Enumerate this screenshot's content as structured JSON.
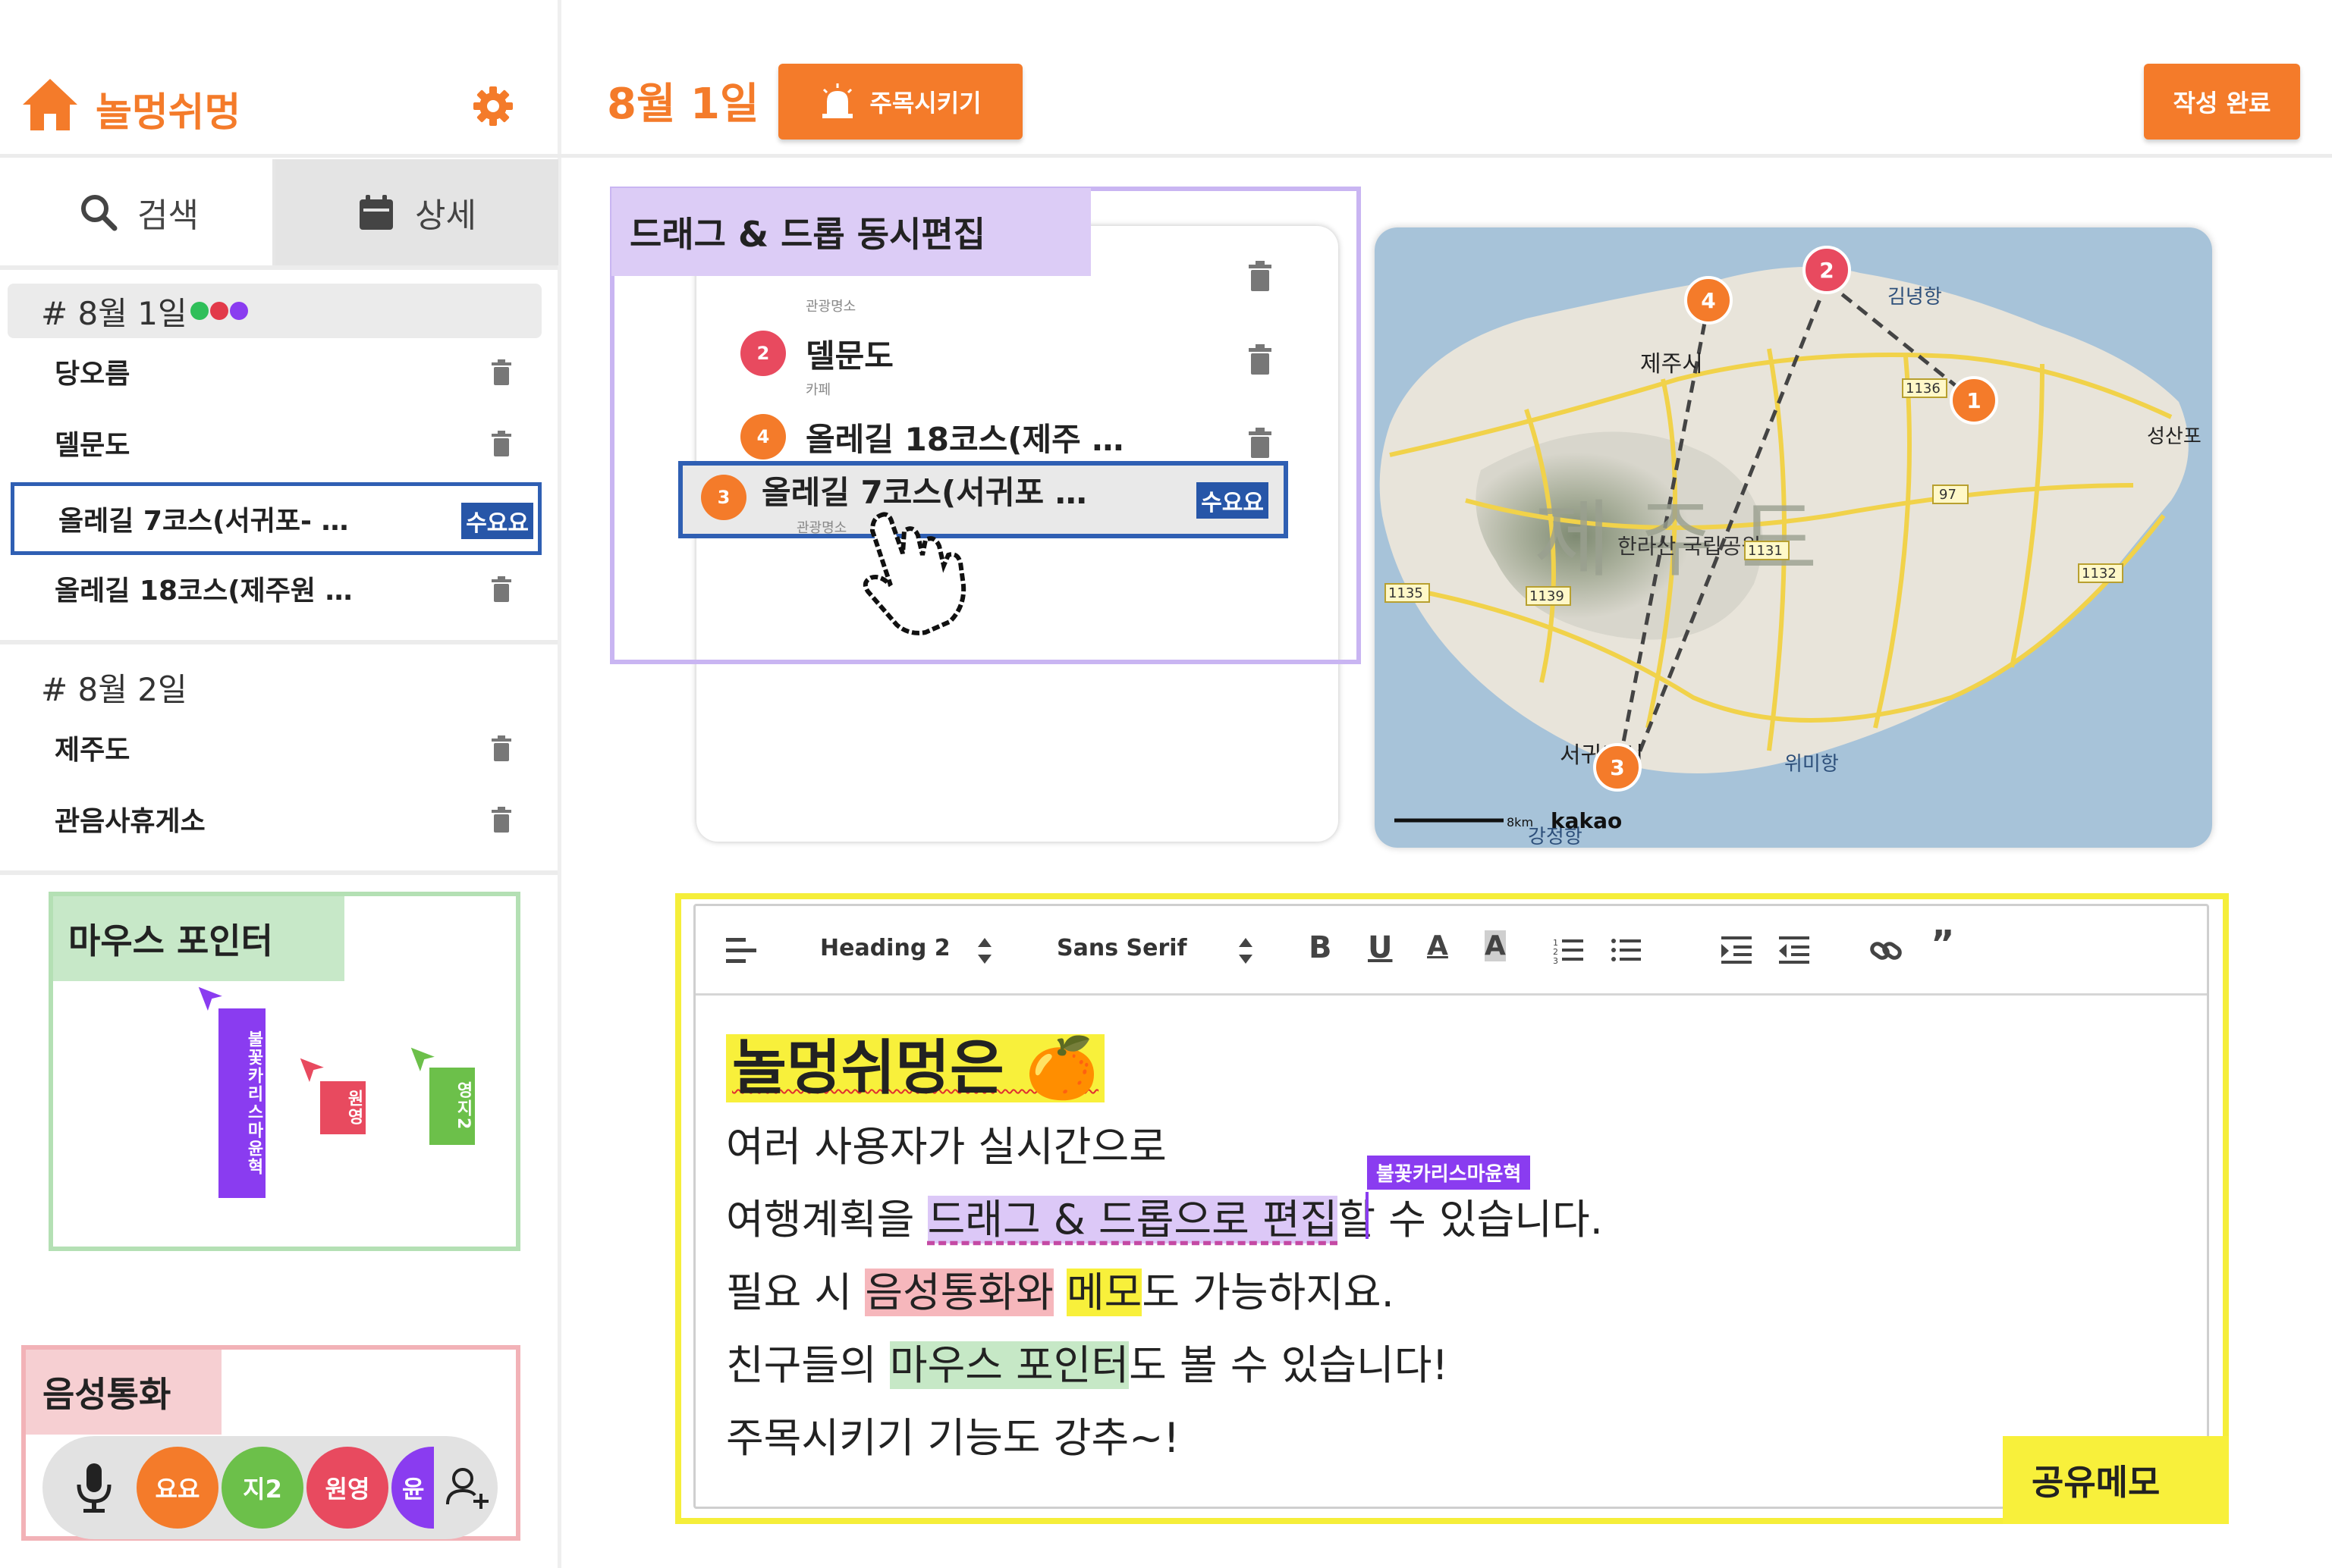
{
  "app": {
    "name": "놀멍쉬멍",
    "home_icon": "home-icon",
    "settings_icon": "gear-icon"
  },
  "colors": {
    "brand_orange": "#f47b2a",
    "select_blue": "#2f5fb3",
    "drag_purple": "#c9b5f2",
    "mouse_green": "#b4e0b4",
    "voice_pink": "#f2b2b7",
    "memo_yellow": "#f5ee3a"
  },
  "tabs": [
    {
      "label": "검색",
      "icon": "search-icon"
    },
    {
      "label": "상세",
      "icon": "calendar-icon",
      "active": true
    }
  ],
  "days": [
    {
      "title": "# 8월 1일",
      "user_dots": [
        "#2fbf5a",
        "#e23a4a",
        "#8a3cf0"
      ],
      "places": [
        {
          "name": "당오름"
        },
        {
          "name": "델문도"
        },
        {
          "name": "올레길 7코스(서귀포- …",
          "tag": "수요요",
          "selected": true
        },
        {
          "name": "올레길 18코스(제주원 …"
        }
      ]
    },
    {
      "title": "# 8월 2일",
      "places": [
        {
          "name": "제주도"
        },
        {
          "name": "관음사휴게소"
        }
      ]
    }
  ],
  "mouse_section": {
    "label": "마우스 포인터",
    "pointers": [
      {
        "name": "불꽃카리스마윤혁",
        "color": "#8a3cf0"
      },
      {
        "name": "원영",
        "color": "#e84a5f"
      },
      {
        "name": "영지2",
        "color": "#6cc04a"
      }
    ]
  },
  "voice_section": {
    "label": "음성통화",
    "mic_icon": "mic-icon",
    "add_icon": "add-user-icon",
    "participants": [
      {
        "name": "요요",
        "color": "#f47b2a"
      },
      {
        "name": "지2",
        "color": "#6cc04a"
      },
      {
        "name": "원영",
        "color": "#e84a5f"
      },
      {
        "name": "윤",
        "color": "#8a3cf0"
      }
    ]
  },
  "header": {
    "date": "8월 1일",
    "spotlight_label": "주목시키기",
    "done_label": "작성 완료"
  },
  "drag_section": {
    "label": "드래그 & 드롭 동시편집",
    "items": [
      {
        "number": "",
        "name": "",
        "category": "관광명소"
      },
      {
        "number": "2",
        "name": "델문도",
        "category": "카페",
        "color": "#e84a5f"
      },
      {
        "number": "4",
        "name": "올레길 18코스(제주 …",
        "category": "",
        "color": "#f47b2a"
      }
    ],
    "dragging": {
      "number": "3",
      "name": "올레길 7코스(서귀포 …",
      "category": "관광명소",
      "tag": "수요요",
      "color": "#f47b2a"
    }
  },
  "map": {
    "island_label": "제 주 도",
    "places": [
      "제주시",
      "서귀포시",
      "김녕항",
      "성산포",
      "위미항",
      "강정항",
      "한라산 국립공원"
    ],
    "road_numbers": [
      "1136",
      "97",
      "1131",
      "1135",
      "1139",
      "1132"
    ],
    "pins": [
      "1",
      "2",
      "3",
      "4"
    ],
    "scale_label": "8km",
    "provider": "kakao"
  },
  "memo": {
    "label": "공유메모",
    "toolbar": {
      "heading": "Heading 2",
      "font": "Sans Serif"
    },
    "cursor_user": "불꽃카리스마윤혁",
    "title": "놀멍쉬멍은 🍊",
    "line1": "여러 사용자가 실시간으로",
    "line2_a": "여행계획을 ",
    "line2_b": "드래그 & 드롭으로 편집",
    "line2_c": "할 수 있습니다.",
    "line3_a": "필요 시 ",
    "line3_b": "음성통화와",
    "line3_c": " ",
    "line3_d": "메모",
    "line3_e": "도 가능하지요.",
    "line4_a": "친구들의 ",
    "line4_b": "마우스 포인터",
    "line4_c": "도 볼 수 있습니다!",
    "line5": "주목시키기 기능도 강추~!"
  }
}
